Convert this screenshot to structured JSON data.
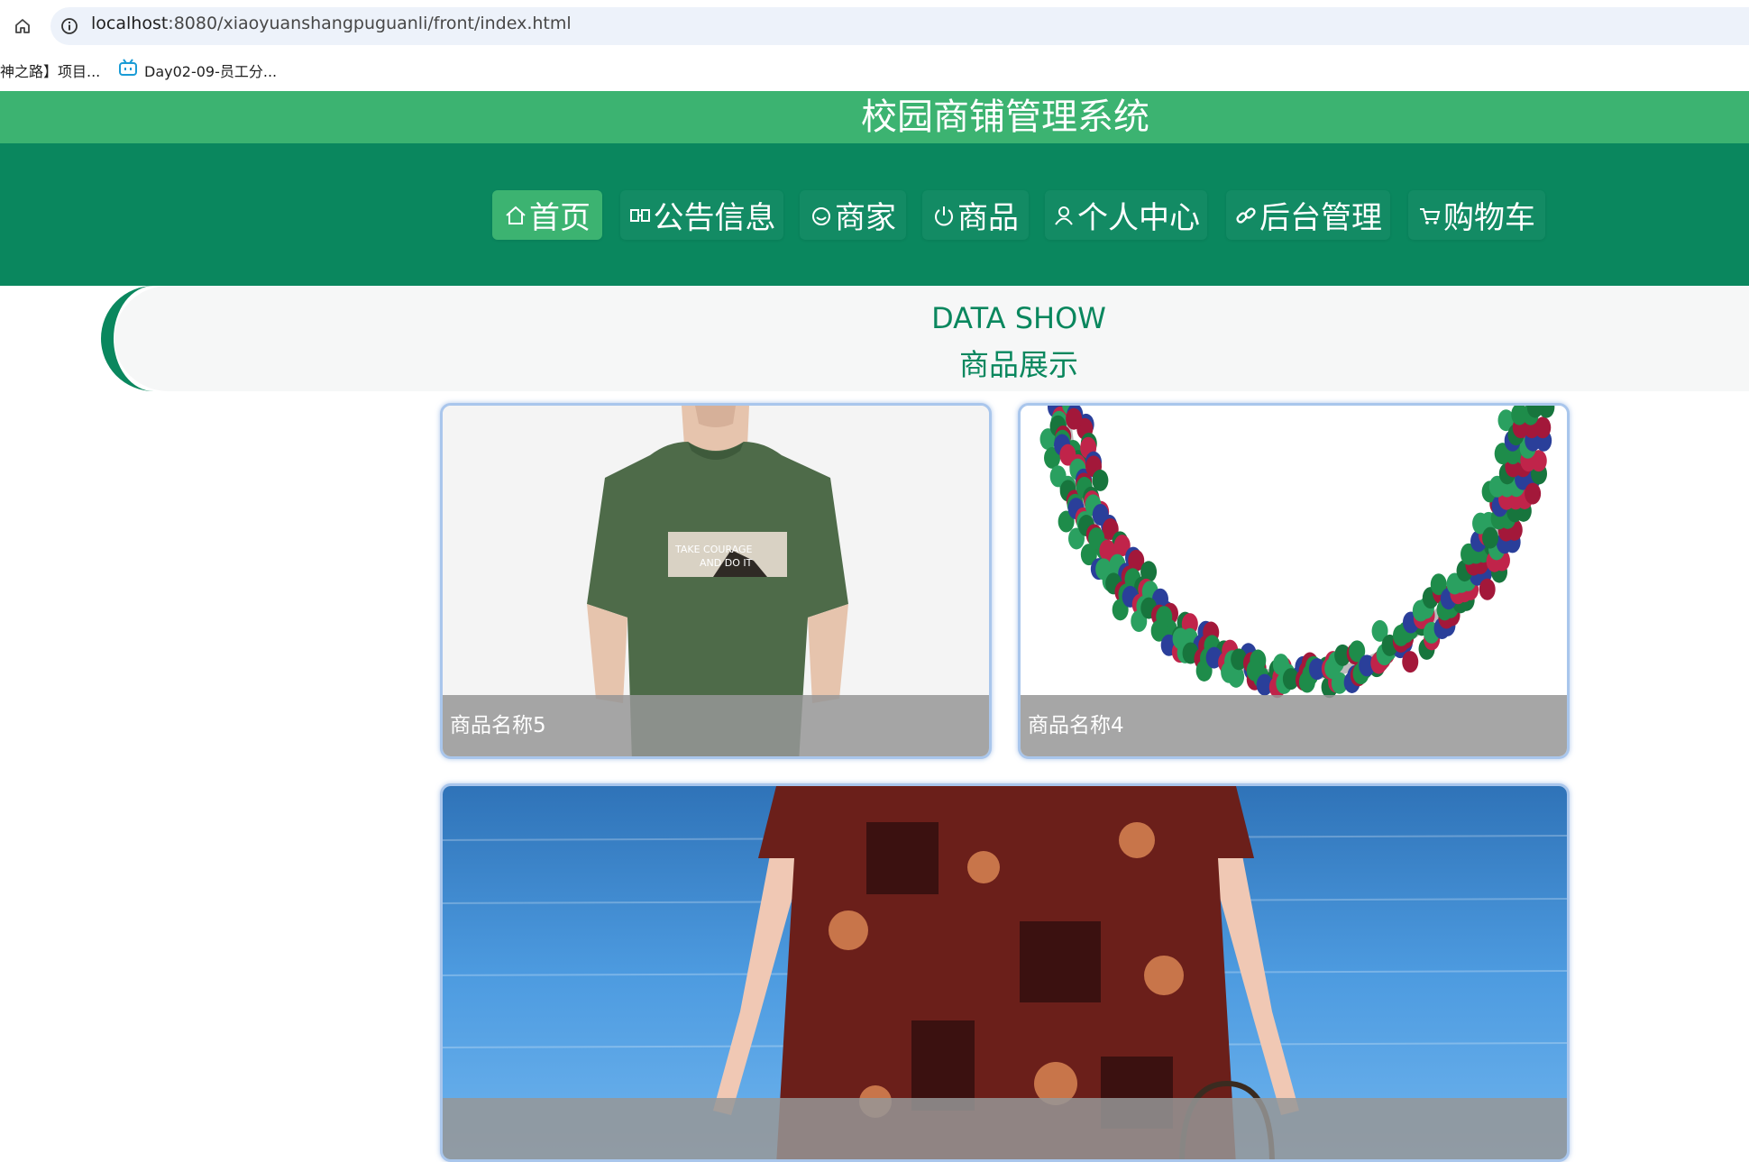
{
  "browser": {
    "url_host": "localhost",
    "url_path": ":8080/xiaoyuanshangpuguanli/front/index.html",
    "bookmarks": [
      {
        "label": "神之路】项目..."
      },
      {
        "label": "Day02-09-员工分..."
      }
    ]
  },
  "site": {
    "title": "校园商铺管理系统"
  },
  "nav": {
    "items": [
      {
        "label": "首页",
        "icon": "home-icon",
        "active": true
      },
      {
        "label": "公告信息",
        "icon": "announcement-icon",
        "active": false
      },
      {
        "label": "商家",
        "icon": "store-icon",
        "active": false
      },
      {
        "label": "商品",
        "icon": "power-icon",
        "active": false
      },
      {
        "label": "个人中心",
        "icon": "user-icon",
        "active": false
      },
      {
        "label": "后台管理",
        "icon": "link-icon",
        "active": false
      },
      {
        "label": "购物车",
        "icon": "cart-icon",
        "active": false
      }
    ]
  },
  "section": {
    "title_en": "DATA SHOW",
    "title_zh": "商品展示"
  },
  "products": [
    {
      "name": "商品名称5",
      "image": "green-tshirt-photo"
    },
    {
      "name": "商品名称4",
      "image": "gemstone-necklace-photo"
    },
    {
      "name": "",
      "image": "floral-dress-seaside-photo"
    }
  ],
  "colors": {
    "title_bar": "#3cb371",
    "nav_bar": "#0a875e",
    "active_nav": "#3cb371",
    "section_text": "#0a875e",
    "card_border": "#a9c6ec"
  }
}
